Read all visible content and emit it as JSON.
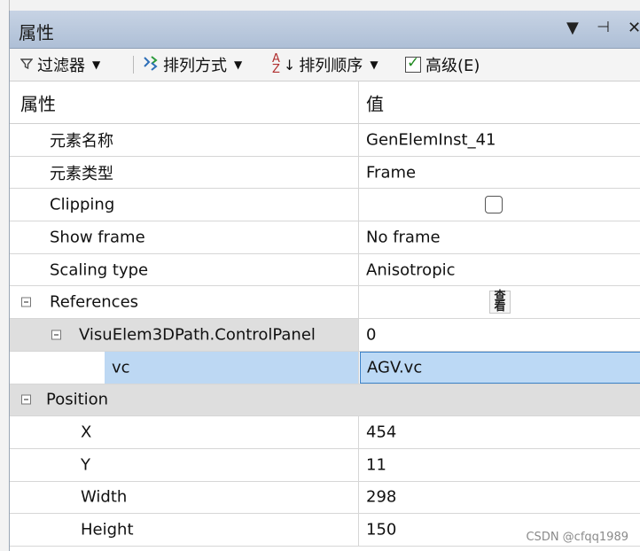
{
  "panel": {
    "title": "属性",
    "buttons": {
      "dropdown": "▼",
      "pin": "⊣",
      "close": "✕"
    }
  },
  "toolbar": {
    "filter_label": "过滤器",
    "sort_mode_label": "排列方式",
    "sort_order_label": "排列顺序",
    "sort_order_icon_top": "A",
    "sort_order_icon_bottom": "Z",
    "advanced_label": "高级(E)",
    "advanced_checked": true,
    "caret": "▼"
  },
  "grid": {
    "header": {
      "name": "属性",
      "value": "值"
    },
    "rows": [
      {
        "name": "元素名称",
        "value": "GenElemInst_41"
      },
      {
        "name": "元素类型",
        "value": "Frame"
      },
      {
        "name": "Clipping",
        "value": "",
        "checkbox": false
      },
      {
        "name": "Show frame",
        "value": "No frame"
      },
      {
        "name": "Scaling type",
        "value": "Anisotropic"
      },
      {
        "name": "References",
        "value": "",
        "ref_button": "查看"
      },
      {
        "name": "VisuElem3DPath.ControlPanel",
        "value": "0"
      },
      {
        "name": "vc",
        "value": "AGV.vc"
      },
      {
        "name": "Position",
        "value": ""
      },
      {
        "name": "X",
        "value": "454"
      },
      {
        "name": "Y",
        "value": "11"
      },
      {
        "name": "Width",
        "value": "298"
      },
      {
        "name": "Height",
        "value": "150"
      }
    ]
  },
  "watermark": "CSDN @cfqq1989",
  "colors": {
    "titlebar": "#aebfd6",
    "selection": "#bcd9f5",
    "group_bg": "#dedede"
  }
}
